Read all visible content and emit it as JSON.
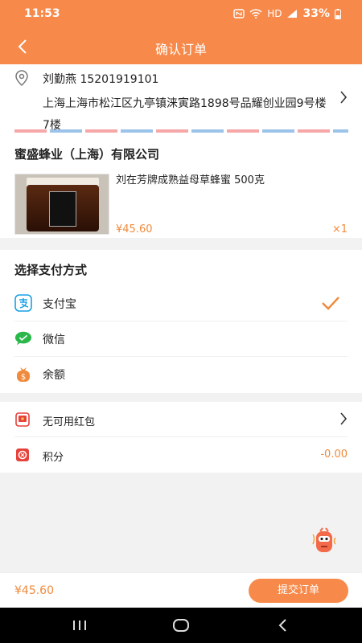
{
  "status_bar": {
    "time": "11:53",
    "battery": "33%",
    "network": "HD",
    "signal_icons": [
      "nfc-icon",
      "wifi-icon",
      "signal-icon",
      "battery-icon"
    ]
  },
  "header": {
    "title": "确认订单"
  },
  "address": {
    "name_phone": "刘勤燕 15201919101",
    "detail": "上海上海市松江区九亭镇涞寅路1898号品耀创业园9号楼7楼"
  },
  "shop": {
    "name": "蜜盛蜂业（上海）有限公司",
    "product": {
      "name": "刘在芳牌成熟益母草蜂蜜 500克",
      "price": "¥45.60",
      "quantity": "×1"
    }
  },
  "payment": {
    "title": "选择支付方式",
    "options": [
      {
        "label": "支付宝",
        "icon": "alipay-icon",
        "selected": true
      },
      {
        "label": "微信",
        "icon": "wechat-icon",
        "selected": false
      },
      {
        "label": "余额",
        "icon": "wallet-icon",
        "selected": false
      }
    ]
  },
  "extras": {
    "red_packet": "无可用红包",
    "points_label": "积分",
    "points_value": "-0.00"
  },
  "footer": {
    "total": "¥45.60",
    "submit_label": "提交订单"
  },
  "colors": {
    "accent": "#f7894a",
    "price": "#f08a3c",
    "alipay": "#1aa0e6",
    "wechat": "#2bb84a",
    "red_packet": "#e6413a"
  }
}
